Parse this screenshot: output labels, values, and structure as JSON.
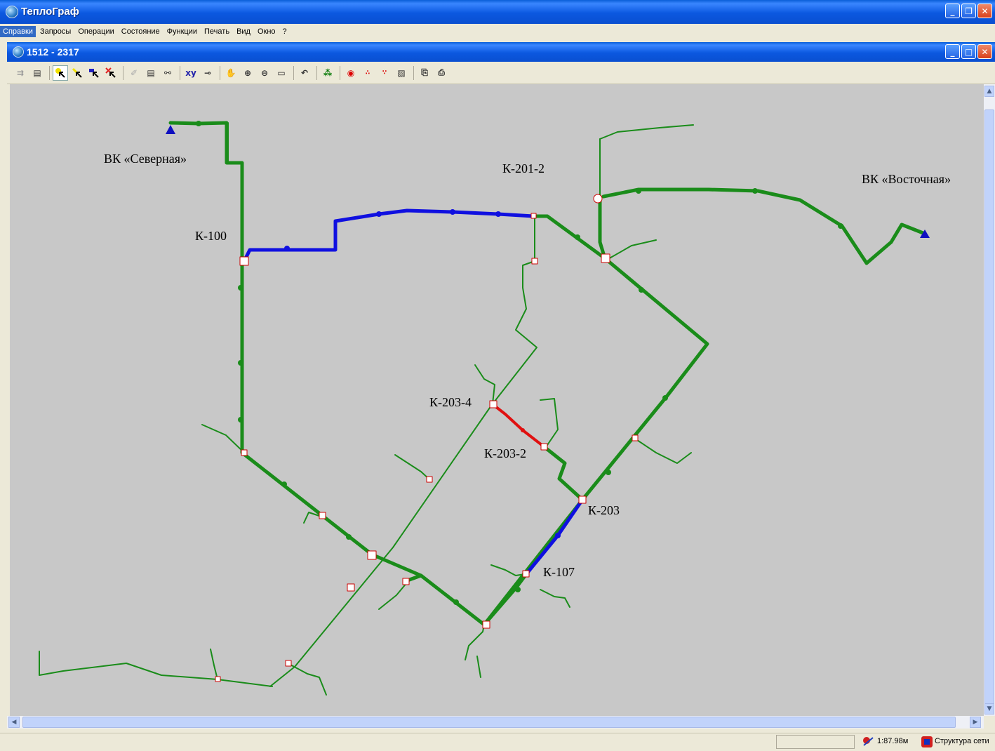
{
  "app": {
    "title": "ТеплоГраф",
    "icon": "globe-icon"
  },
  "menu": {
    "items": [
      {
        "label": "Справки",
        "active": true
      },
      {
        "label": "Запросы"
      },
      {
        "label": "Операции"
      },
      {
        "label": "Состояние"
      },
      {
        "label": "Функции"
      },
      {
        "label": "Печать"
      },
      {
        "label": "Вид"
      },
      {
        "label": "Окно"
      },
      {
        "label": "?"
      }
    ]
  },
  "document": {
    "title": "1512 - 2317"
  },
  "toolbar": {
    "buttons": [
      "export-icon",
      "properties-icon",
      "select-node-icon",
      "select-edge-icon",
      "select-object-icon",
      "select-multi-icon",
      "erase-icon",
      "select-area-icon",
      "search-icon",
      "coordinates-icon",
      "measure-icon",
      "pan-icon",
      "zoom-in-icon",
      "zoom-out-icon",
      "zoom-extent-icon",
      "undo-icon",
      "traffic-light-icon",
      "target-icon",
      "network-nodes-icon",
      "network-branch-icon",
      "chart-icon",
      "copy-icon",
      "print-icon"
    ]
  },
  "map": {
    "labels": {
      "vk_north": "ВК «Северная»",
      "k201_2": "К-201-2",
      "vk_east": "ВК «Восточная»",
      "k100": "К-100",
      "k203_4": "К-203-4",
      "k203_2": "К-203-2",
      "k203": "К-203",
      "k107": "К-107"
    },
    "colors": {
      "main": "#1a8c1a",
      "highlight_blue": "#1010e0",
      "highlight_red": "#e01010",
      "background": "#c8c8c8"
    }
  },
  "status": {
    "scale": "1:87.98м",
    "mode": "Структура сети"
  }
}
